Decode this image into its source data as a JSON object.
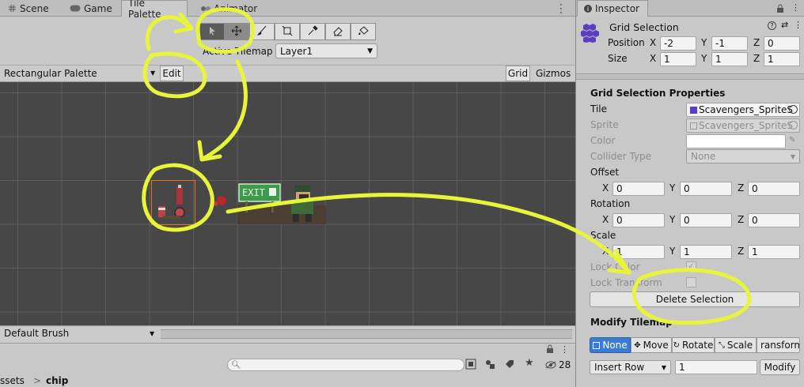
{
  "tabs": [
    {
      "label": "Scene",
      "icon": "grid-icon"
    },
    {
      "label": "Game",
      "icon": "gamepad-icon"
    },
    {
      "label": "Tile Palette"
    },
    {
      "label": "Animator",
      "icon": "animator-icon"
    }
  ],
  "inspector_tab": {
    "label": "Inspector",
    "icon": "info-icon"
  },
  "tools": [
    "select-tool-icon",
    "move-tool-icon",
    "brush-tool-icon",
    "box-fill-tool-icon",
    "picker-tool-icon",
    "eraser-tool-icon",
    "fill-tool-icon"
  ],
  "palette": {
    "active_tilemap_label": "Active Tilemap",
    "active_tilemap_value": "Layer1",
    "palette_name": "Rectangular Palette",
    "edit_label": "Edit",
    "grid_label": "Grid",
    "gizmos_label": "Gizmos",
    "brush": "Default Brush"
  },
  "project": {
    "breadcrumb_root": "ssets",
    "breadcrumb_sep": ">",
    "breadcrumb_child": "chip",
    "hidden_count": "28",
    "search_placeholder": ""
  },
  "inspector": {
    "header_title": "Grid Selection",
    "position_label": "Position",
    "size_label": "Size",
    "position": {
      "x": "-2",
      "y": "-1",
      "z": "0"
    },
    "size": {
      "x": "1",
      "y": "1",
      "z": "1"
    },
    "axis_x": "X",
    "axis_y": "Y",
    "axis_z": "Z",
    "section_title": "Grid Selection Properties",
    "tile_label": "Tile",
    "tile_value": "Scavengers_SpriteS",
    "sprite_label": "Sprite",
    "sprite_value": "Scavengers_SpriteS",
    "color_label": "Color",
    "collider_label": "Collider Type",
    "collider_value": "None",
    "offset_label": "Offset",
    "offset": {
      "x": "0",
      "y": "0",
      "z": "0"
    },
    "rotation_label": "Rotation",
    "rotation": {
      "x": "0",
      "y": "0",
      "z": "0"
    },
    "scale_label": "Scale",
    "scale": {
      "x": "1",
      "y": "1",
      "z": "1"
    },
    "lock_color_label": "Lock Color",
    "lock_transform_label": "Lock Transform",
    "delete_button": "Delete Selection",
    "modify_title": "Modify Tilemap",
    "modes": [
      {
        "label": "None",
        "icon": "none-icon"
      },
      {
        "label": "Move",
        "icon": "move-icon"
      },
      {
        "label": "Rotate",
        "icon": "rotate-icon"
      },
      {
        "label": "Scale",
        "icon": "scale-icon"
      },
      {
        "label": "ransform",
        "icon": ""
      }
    ],
    "insert_option": "Insert Row",
    "insert_count": "1",
    "modify_button": "Modify"
  },
  "colors": {
    "accent": "#3a7bd5",
    "annotation": "#e6f53a",
    "selection": "#e8701a",
    "grid_bg": "#474747"
  }
}
